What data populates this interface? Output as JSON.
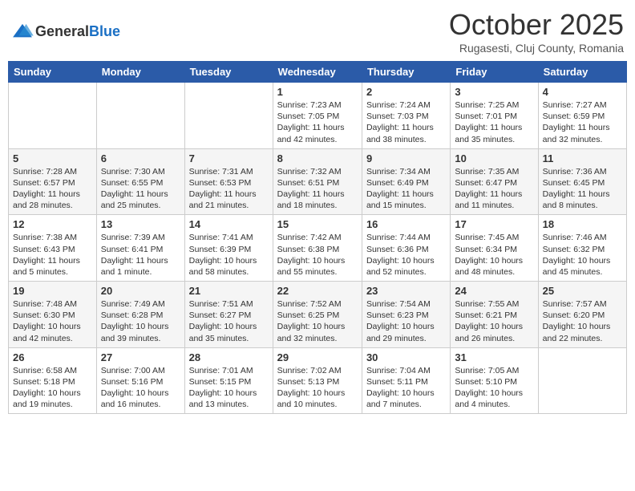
{
  "header": {
    "logo_general": "General",
    "logo_blue": "Blue",
    "month": "October 2025",
    "location": "Rugasesti, Cluj County, Romania"
  },
  "weekdays": [
    "Sunday",
    "Monday",
    "Tuesday",
    "Wednesday",
    "Thursday",
    "Friday",
    "Saturday"
  ],
  "weeks": [
    [
      {
        "day": "",
        "info": ""
      },
      {
        "day": "",
        "info": ""
      },
      {
        "day": "",
        "info": ""
      },
      {
        "day": "1",
        "info": "Sunrise: 7:23 AM\nSunset: 7:05 PM\nDaylight: 11 hours and 42 minutes."
      },
      {
        "day": "2",
        "info": "Sunrise: 7:24 AM\nSunset: 7:03 PM\nDaylight: 11 hours and 38 minutes."
      },
      {
        "day": "3",
        "info": "Sunrise: 7:25 AM\nSunset: 7:01 PM\nDaylight: 11 hours and 35 minutes."
      },
      {
        "day": "4",
        "info": "Sunrise: 7:27 AM\nSunset: 6:59 PM\nDaylight: 11 hours and 32 minutes."
      }
    ],
    [
      {
        "day": "5",
        "info": "Sunrise: 7:28 AM\nSunset: 6:57 PM\nDaylight: 11 hours and 28 minutes."
      },
      {
        "day": "6",
        "info": "Sunrise: 7:30 AM\nSunset: 6:55 PM\nDaylight: 11 hours and 25 minutes."
      },
      {
        "day": "7",
        "info": "Sunrise: 7:31 AM\nSunset: 6:53 PM\nDaylight: 11 hours and 21 minutes."
      },
      {
        "day": "8",
        "info": "Sunrise: 7:32 AM\nSunset: 6:51 PM\nDaylight: 11 hours and 18 minutes."
      },
      {
        "day": "9",
        "info": "Sunrise: 7:34 AM\nSunset: 6:49 PM\nDaylight: 11 hours and 15 minutes."
      },
      {
        "day": "10",
        "info": "Sunrise: 7:35 AM\nSunset: 6:47 PM\nDaylight: 11 hours and 11 minutes."
      },
      {
        "day": "11",
        "info": "Sunrise: 7:36 AM\nSunset: 6:45 PM\nDaylight: 11 hours and 8 minutes."
      }
    ],
    [
      {
        "day": "12",
        "info": "Sunrise: 7:38 AM\nSunset: 6:43 PM\nDaylight: 11 hours and 5 minutes."
      },
      {
        "day": "13",
        "info": "Sunrise: 7:39 AM\nSunset: 6:41 PM\nDaylight: 11 hours and 1 minute."
      },
      {
        "day": "14",
        "info": "Sunrise: 7:41 AM\nSunset: 6:39 PM\nDaylight: 10 hours and 58 minutes."
      },
      {
        "day": "15",
        "info": "Sunrise: 7:42 AM\nSunset: 6:38 PM\nDaylight: 10 hours and 55 minutes."
      },
      {
        "day": "16",
        "info": "Sunrise: 7:44 AM\nSunset: 6:36 PM\nDaylight: 10 hours and 52 minutes."
      },
      {
        "day": "17",
        "info": "Sunrise: 7:45 AM\nSunset: 6:34 PM\nDaylight: 10 hours and 48 minutes."
      },
      {
        "day": "18",
        "info": "Sunrise: 7:46 AM\nSunset: 6:32 PM\nDaylight: 10 hours and 45 minutes."
      }
    ],
    [
      {
        "day": "19",
        "info": "Sunrise: 7:48 AM\nSunset: 6:30 PM\nDaylight: 10 hours and 42 minutes."
      },
      {
        "day": "20",
        "info": "Sunrise: 7:49 AM\nSunset: 6:28 PM\nDaylight: 10 hours and 39 minutes."
      },
      {
        "day": "21",
        "info": "Sunrise: 7:51 AM\nSunset: 6:27 PM\nDaylight: 10 hours and 35 minutes."
      },
      {
        "day": "22",
        "info": "Sunrise: 7:52 AM\nSunset: 6:25 PM\nDaylight: 10 hours and 32 minutes."
      },
      {
        "day": "23",
        "info": "Sunrise: 7:54 AM\nSunset: 6:23 PM\nDaylight: 10 hours and 29 minutes."
      },
      {
        "day": "24",
        "info": "Sunrise: 7:55 AM\nSunset: 6:21 PM\nDaylight: 10 hours and 26 minutes."
      },
      {
        "day": "25",
        "info": "Sunrise: 7:57 AM\nSunset: 6:20 PM\nDaylight: 10 hours and 22 minutes."
      }
    ],
    [
      {
        "day": "26",
        "info": "Sunrise: 6:58 AM\nSunset: 5:18 PM\nDaylight: 10 hours and 19 minutes."
      },
      {
        "day": "27",
        "info": "Sunrise: 7:00 AM\nSunset: 5:16 PM\nDaylight: 10 hours and 16 minutes."
      },
      {
        "day": "28",
        "info": "Sunrise: 7:01 AM\nSunset: 5:15 PM\nDaylight: 10 hours and 13 minutes."
      },
      {
        "day": "29",
        "info": "Sunrise: 7:02 AM\nSunset: 5:13 PM\nDaylight: 10 hours and 10 minutes."
      },
      {
        "day": "30",
        "info": "Sunrise: 7:04 AM\nSunset: 5:11 PM\nDaylight: 10 hours and 7 minutes."
      },
      {
        "day": "31",
        "info": "Sunrise: 7:05 AM\nSunset: 5:10 PM\nDaylight: 10 hours and 4 minutes."
      },
      {
        "day": "",
        "info": ""
      }
    ]
  ]
}
